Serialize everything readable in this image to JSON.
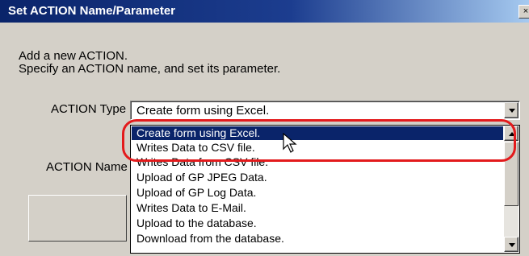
{
  "dialog": {
    "title": "Set ACTION Name/Parameter",
    "close_symbol": "×",
    "intro_line1": "Add a new ACTION.",
    "intro_line2": "Specify an ACTION name, and set its parameter."
  },
  "action_type": {
    "label": "ACTION Type",
    "selected_value": "Create form using Excel.",
    "options": [
      "Create form using Excel.",
      "Writes Data to CSV file.",
      "Writes Data from CSV file.",
      "Upload of GP JPEG Data.",
      "Upload of GP Log Data.",
      "Writes Data to E-Mail.",
      "Upload to the database.",
      "Download from the database."
    ],
    "highlighted_index": 0
  },
  "action_name": {
    "label": "ACTION Name"
  },
  "colors": {
    "title_bar": "#0a246a",
    "selection": "#0a246a",
    "annotation": "#e31a1c",
    "dialog_bg": "#d4d0c8"
  },
  "icons": {
    "dropdown_arrow": "chevron-down-icon",
    "scroll_up": "scroll-up-arrow-icon",
    "scroll_down": "scroll-down-arrow-icon",
    "pointer": "mouse-pointer-icon"
  }
}
